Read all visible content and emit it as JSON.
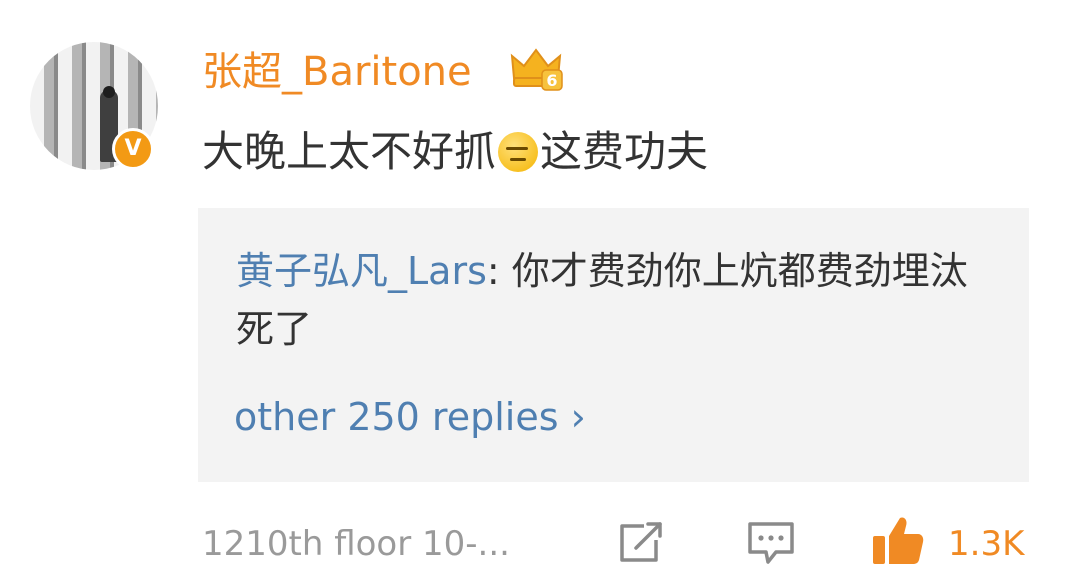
{
  "comment": {
    "username": "张超_Baritone",
    "level_badge": "6",
    "verified_badge": "V",
    "text_before_emoji": "大晚上太不好抓",
    "emoji": "smirk-emoji",
    "text_after_emoji": "这费功夫"
  },
  "reply_preview": {
    "username": "黄子弘凡_Lars",
    "separator": ": ",
    "text": "你才费劲你上炕都费劲埋汰死了",
    "more_replies_label": "other 250 replies",
    "more_replies_chevron": "›"
  },
  "footer": {
    "floor_info": "1210th floor 10-...",
    "share_icon": "share-icon",
    "comment_icon": "comment-icon",
    "like_icon": "thumbs-up-icon",
    "like_count": "1.3K"
  },
  "colors": {
    "username": "#f08a24",
    "reply_username": "#4f7fb1",
    "text": "#333333",
    "muted": "#9a9a9a",
    "reply_bg": "#f3f3f3",
    "like": "#f08a24"
  }
}
